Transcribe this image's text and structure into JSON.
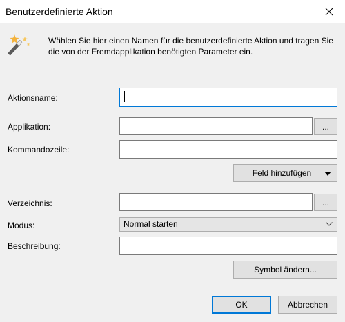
{
  "window": {
    "title": "Benutzerdefinierte Aktion",
    "close_icon": "close-icon"
  },
  "header": {
    "icon": "magic-wand-icon",
    "text": "Wählen Sie hier einen Namen für die benutzerdefinierte Aktion und tragen Sie die von der Fremdapplikation benötigten Parameter ein."
  },
  "form": {
    "action_name": {
      "label": "Aktionsname:",
      "value": ""
    },
    "application": {
      "label": "Applikation:",
      "value": "",
      "browse_label": "..."
    },
    "command_line": {
      "label": "Kommandozeile:",
      "value": ""
    },
    "add_field_button": {
      "label": "Feld hinzufügen",
      "icon": "triangle-down-icon"
    },
    "directory": {
      "label": "Verzeichnis:",
      "value": "",
      "browse_label": "..."
    },
    "mode": {
      "label": "Modus:",
      "selected": "Normal starten"
    },
    "description": {
      "label": "Beschreibung:",
      "value": ""
    },
    "change_symbol_button": {
      "label": "Symbol ändern..."
    }
  },
  "footer": {
    "ok_label": "OK",
    "cancel_label": "Abbrechen"
  },
  "colors": {
    "accent": "#0078d7",
    "background": "#f0f0f0"
  }
}
